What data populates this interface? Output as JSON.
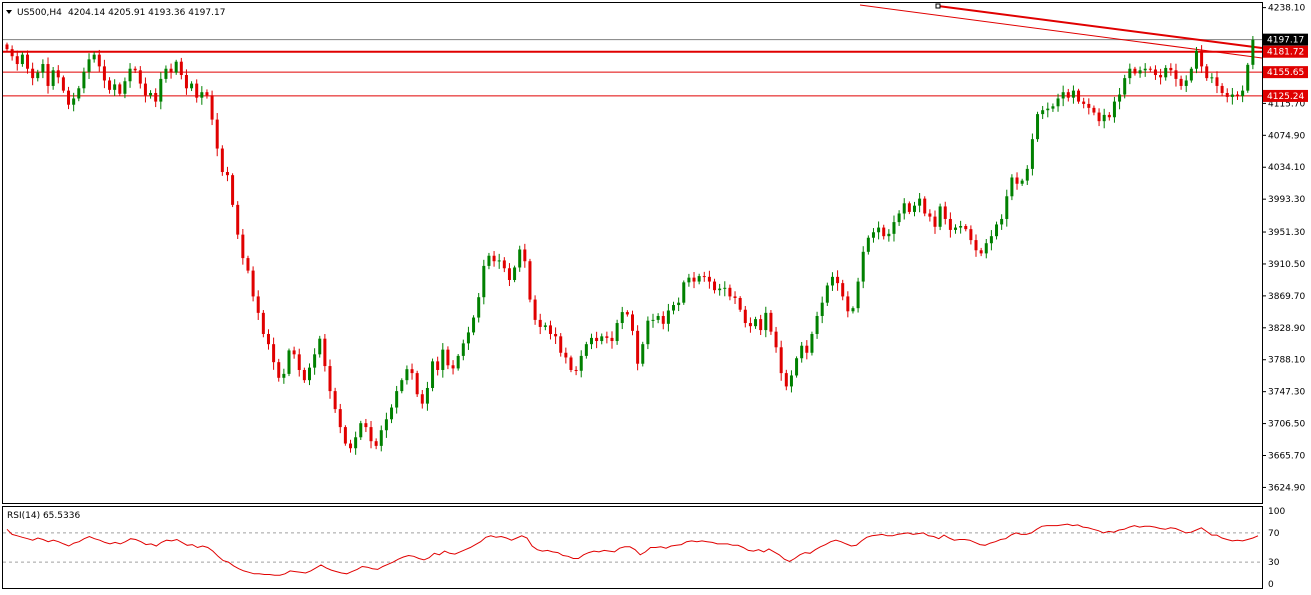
{
  "header": {
    "symbol": "US500,H4",
    "ohlc": "4204.14 4205.91 4193.36 4197.17"
  },
  "indicator": {
    "label": "RSI(14) 65.5336",
    "levels": [
      "100",
      "70",
      "30",
      "0"
    ]
  },
  "colors": {
    "bull": "#008000",
    "bear": "#e00000",
    "level_line": "#e00000",
    "rsi_line": "#e00000",
    "grid_text": "#000000",
    "last_price_bg": "#000000",
    "current_price_line": "#808080"
  },
  "chart_data": {
    "type": "candlestick",
    "ylim": [
      3605,
      4244
    ],
    "y_ticks": [
      "4238.10",
      "4197.17",
      "4181.72",
      "4155.65",
      "4125.24",
      "4115.70",
      "4074.90",
      "4034.10",
      "3993.30",
      "3951.30",
      "3910.50",
      "3869.70",
      "3828.90",
      "3788.10",
      "3747.30",
      "3706.50",
      "3665.70",
      "3624.90"
    ],
    "last_price": 4197.17,
    "price_labels": [
      {
        "value": "4197.17",
        "style": "current"
      },
      {
        "value": "4181.72",
        "style": "level"
      },
      {
        "value": "4155.65",
        "style": "level"
      },
      {
        "value": "4125.24",
        "style": "level"
      }
    ],
    "horizontal_levels": [
      4181.72,
      4155.65,
      4125.24
    ],
    "close_path": [
      4185,
      4176,
      4166,
      4178,
      4160,
      4148,
      4155,
      4166,
      4138,
      4158,
      4149,
      4132,
      4114,
      4122,
      4135,
      4156,
      4172,
      4178,
      4163,
      4145,
      4133,
      4140,
      4128,
      4144,
      4160,
      4158,
      4141,
      4126,
      4129,
      4118,
      4147,
      4160,
      4155,
      4169,
      4152,
      4135,
      4141,
      4123,
      4130,
      4126,
      4095,
      4058,
      4028,
      4024,
      3986,
      3948,
      3918,
      3902,
      3869,
      3848,
      3821,
      3808,
      3785,
      3765,
      3770,
      3800,
      3795,
      3775,
      3762,
      3778,
      3795,
      3815,
      3780,
      3748,
      3725,
      3702,
      3681,
      3675,
      3689,
      3707,
      3702,
      3684,
      3678,
      3698,
      3712,
      3727,
      3748,
      3762,
      3776,
      3771,
      3744,
      3732,
      3752,
      3786,
      3775,
      3801,
      3781,
      3777,
      3793,
      3809,
      3823,
      3842,
      3868,
      3908,
      3921,
      3914,
      3915,
      3905,
      3890,
      3906,
      3929,
      3914,
      3865,
      3839,
      3830,
      3832,
      3821,
      3818,
      3797,
      3791,
      3775,
      3774,
      3793,
      3808,
      3816,
      3812,
      3818,
      3816,
      3812,
      3835,
      3849,
      3846,
      3825,
      3783,
      3808,
      3838,
      3839,
      3844,
      3834,
      3851,
      3858,
      3861,
      3887,
      3893,
      3888,
      3895,
      3894,
      3888,
      3877,
      3879,
      3880,
      3869,
      3867,
      3852,
      3835,
      3831,
      3840,
      3826,
      3848,
      3824,
      3804,
      3771,
      3754,
      3768,
      3790,
      3806,
      3797,
      3821,
      3844,
      3861,
      3883,
      3894,
      3886,
      3869,
      3850,
      3854,
      3888,
      3926,
      3944,
      3951,
      3957,
      3946,
      3949,
      3964,
      3975,
      3988,
      3977,
      3985,
      3994,
      3975,
      3971,
      3958,
      3984,
      3968,
      3954,
      3957,
      3959,
      3955,
      3941,
      3928,
      3924,
      3937,
      3946,
      3961,
      3968,
      3997,
      4021,
      4013,
      4017,
      4032,
      4070,
      4102,
      4107,
      4109,
      4112,
      4122,
      4130,
      4123,
      4132,
      4118,
      4115,
      4110,
      4104,
      4093,
      4101,
      4098,
      4118,
      4127,
      4148,
      4160,
      4154,
      4158,
      4160,
      4159,
      4152,
      4149,
      4161,
      4158,
      4147,
      4138,
      4145,
      4160,
      4183,
      4163,
      4148,
      4149,
      4138,
      4129,
      4124,
      4127,
      4125,
      4132,
      4165,
      4197
    ],
    "rsi_values": [
      75,
      68,
      66,
      64,
      62,
      60,
      63,
      61,
      58,
      60,
      58,
      55,
      52,
      56,
      58,
      62,
      65,
      62,
      60,
      57,
      55,
      57,
      55,
      58,
      62,
      61,
      58,
      54,
      55,
      52,
      57,
      60,
      59,
      61,
      57,
      53,
      54,
      50,
      52,
      50,
      45,
      38,
      32,
      30,
      25,
      21,
      18,
      16,
      14,
      14,
      13,
      13,
      12,
      12,
      14,
      18,
      17,
      16,
      15,
      18,
      22,
      26,
      22,
      19,
      17,
      15,
      14,
      17,
      20,
      24,
      23,
      21,
      20,
      24,
      27,
      30,
      34,
      37,
      39,
      38,
      35,
      33,
      36,
      42,
      40,
      45,
      42,
      41,
      44,
      47,
      50,
      54,
      58,
      64,
      66,
      64,
      65,
      63,
      60,
      63,
      66,
      63,
      52,
      47,
      45,
      46,
      44,
      43,
      39,
      38,
      35,
      35,
      40,
      43,
      45,
      44,
      46,
      45,
      44,
      49,
      51,
      51,
      47,
      40,
      44,
      50,
      50,
      51,
      49,
      52,
      53,
      54,
      58,
      59,
      58,
      59,
      58,
      57,
      55,
      55,
      55,
      53,
      53,
      50,
      46,
      45,
      47,
      44,
      48,
      44,
      40,
      34,
      31,
      35,
      40,
      43,
      42,
      47,
      51,
      54,
      58,
      60,
      58,
      55,
      52,
      53,
      59,
      64,
      66,
      67,
      68,
      66,
      66,
      68,
      69,
      70,
      68,
      69,
      70,
      66,
      65,
      62,
      67,
      63,
      60,
      61,
      61,
      60,
      57,
      54,
      53,
      56,
      58,
      61,
      62,
      67,
      70,
      68,
      68,
      70,
      75,
      79,
      80,
      80,
      80,
      81,
      82,
      80,
      81,
      78,
      77,
      75,
      73,
      70,
      72,
      71,
      74,
      75,
      78,
      80,
      78,
      79,
      79,
      78,
      76,
      75,
      77,
      76,
      73,
      70,
      71,
      74,
      77,
      72,
      67,
      67,
      63,
      61,
      59,
      60,
      59,
      61,
      63,
      66
    ]
  }
}
